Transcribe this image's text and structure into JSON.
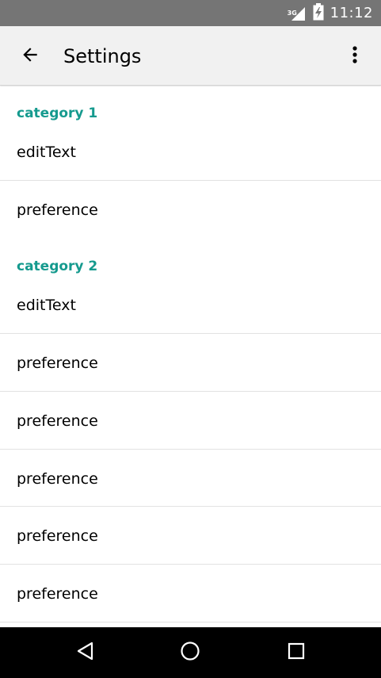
{
  "status_bar": {
    "time": "11:12",
    "network": "3G",
    "icons": [
      "signal-icon",
      "battery-charging-icon"
    ],
    "background": "#757575"
  },
  "app_bar": {
    "title": "Settings",
    "back_icon": "arrow-back-icon",
    "menu_icon": "more-vert-icon",
    "background": "#f1f1f1"
  },
  "settings": {
    "categories": [
      {
        "title": "category 1",
        "items": [
          "editText",
          "preference"
        ]
      },
      {
        "title": "category 2",
        "items": [
          "editText",
          "preference",
          "preference",
          "preference",
          "preference",
          "preference"
        ]
      }
    ],
    "accent_color": "#159a8e"
  },
  "nav_bar": {
    "icons": [
      "back-triangle-icon",
      "home-circle-icon",
      "recents-square-icon"
    ],
    "background": "#000000"
  }
}
